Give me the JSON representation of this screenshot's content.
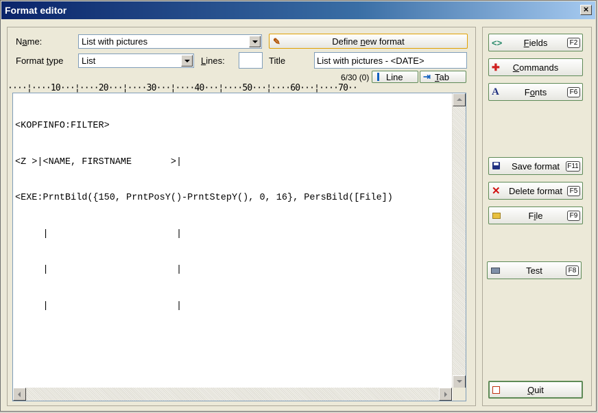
{
  "window": {
    "title": "Format editor",
    "close_glyph": "×"
  },
  "form": {
    "name_label_prefix": "N",
    "name_label_underlined": "a",
    "name_label_rest": "me:",
    "name_value": "List with pictures",
    "format_type_label_prefix": "Format ",
    "format_type_label_underlined": "t",
    "format_type_label_rest": "ype",
    "format_type_value": "List",
    "lines_label_prefix": "",
    "lines_label_underlined": "L",
    "lines_label_rest": "ines:",
    "lines_value": "",
    "title_label": "Title",
    "title_value": "List with pictures - <DATE>",
    "define_button_prefix": "Define ",
    "define_button_underlined": "n",
    "define_button_rest": "ew format",
    "position_status": "6/30 (0)",
    "line_button_label": "Line",
    "tab_button_prefix": "",
    "tab_button_underlined": "T",
    "tab_button_rest": "ab"
  },
  "ruler": "····¦····10···¦····20···¦····30···¦····40···¦····50···¦····60···¦····70··",
  "editor": {
    "lines": [
      "<KOPFINFO:FILTER>",
      "<Z >|<NAME, FIRSTNAME       >|",
      "<EXE:PrntBild({150, PrntPosY()-PrntStepY(), 0, 16}, PersBild([File])",
      "     |                       |",
      "     |                       |",
      "     |                       |"
    ]
  },
  "side_buttons": {
    "fields": {
      "prefix": "",
      "underlined": "F",
      "rest": "ields",
      "key": "F2",
      "icon": "code-brackets-icon",
      "icon_glyph": "<>"
    },
    "commands": {
      "prefix": "",
      "underlined": "C",
      "rest": "ommands",
      "key": "",
      "icon": "plus-icon",
      "icon_glyph": "✚"
    },
    "fonts": {
      "prefix": "F",
      "underlined": "o",
      "rest": "nts",
      "key": "F6",
      "icon": "font-icon",
      "icon_glyph": "A"
    },
    "save": {
      "label": "Save format",
      "key": "F11",
      "icon": "floppy-icon"
    },
    "delete": {
      "label": "Delete format",
      "key": "F5",
      "icon": "delete-x-icon",
      "icon_glyph": "✕"
    },
    "file": {
      "prefix": "F",
      "underlined": "i",
      "rest": "le",
      "key": "F9",
      "icon": "folder-icon"
    },
    "test": {
      "label": "Test",
      "key": "F8",
      "icon": "printer-icon"
    },
    "quit": {
      "prefix": "",
      "underlined": "Q",
      "rest": "uit",
      "icon": "exit-icon"
    }
  },
  "colors": {
    "title_bar_start": "#0a246a",
    "title_bar_end": "#a6caf0",
    "button_border": "#5e8a56",
    "define_button_border": "#e0a000"
  }
}
